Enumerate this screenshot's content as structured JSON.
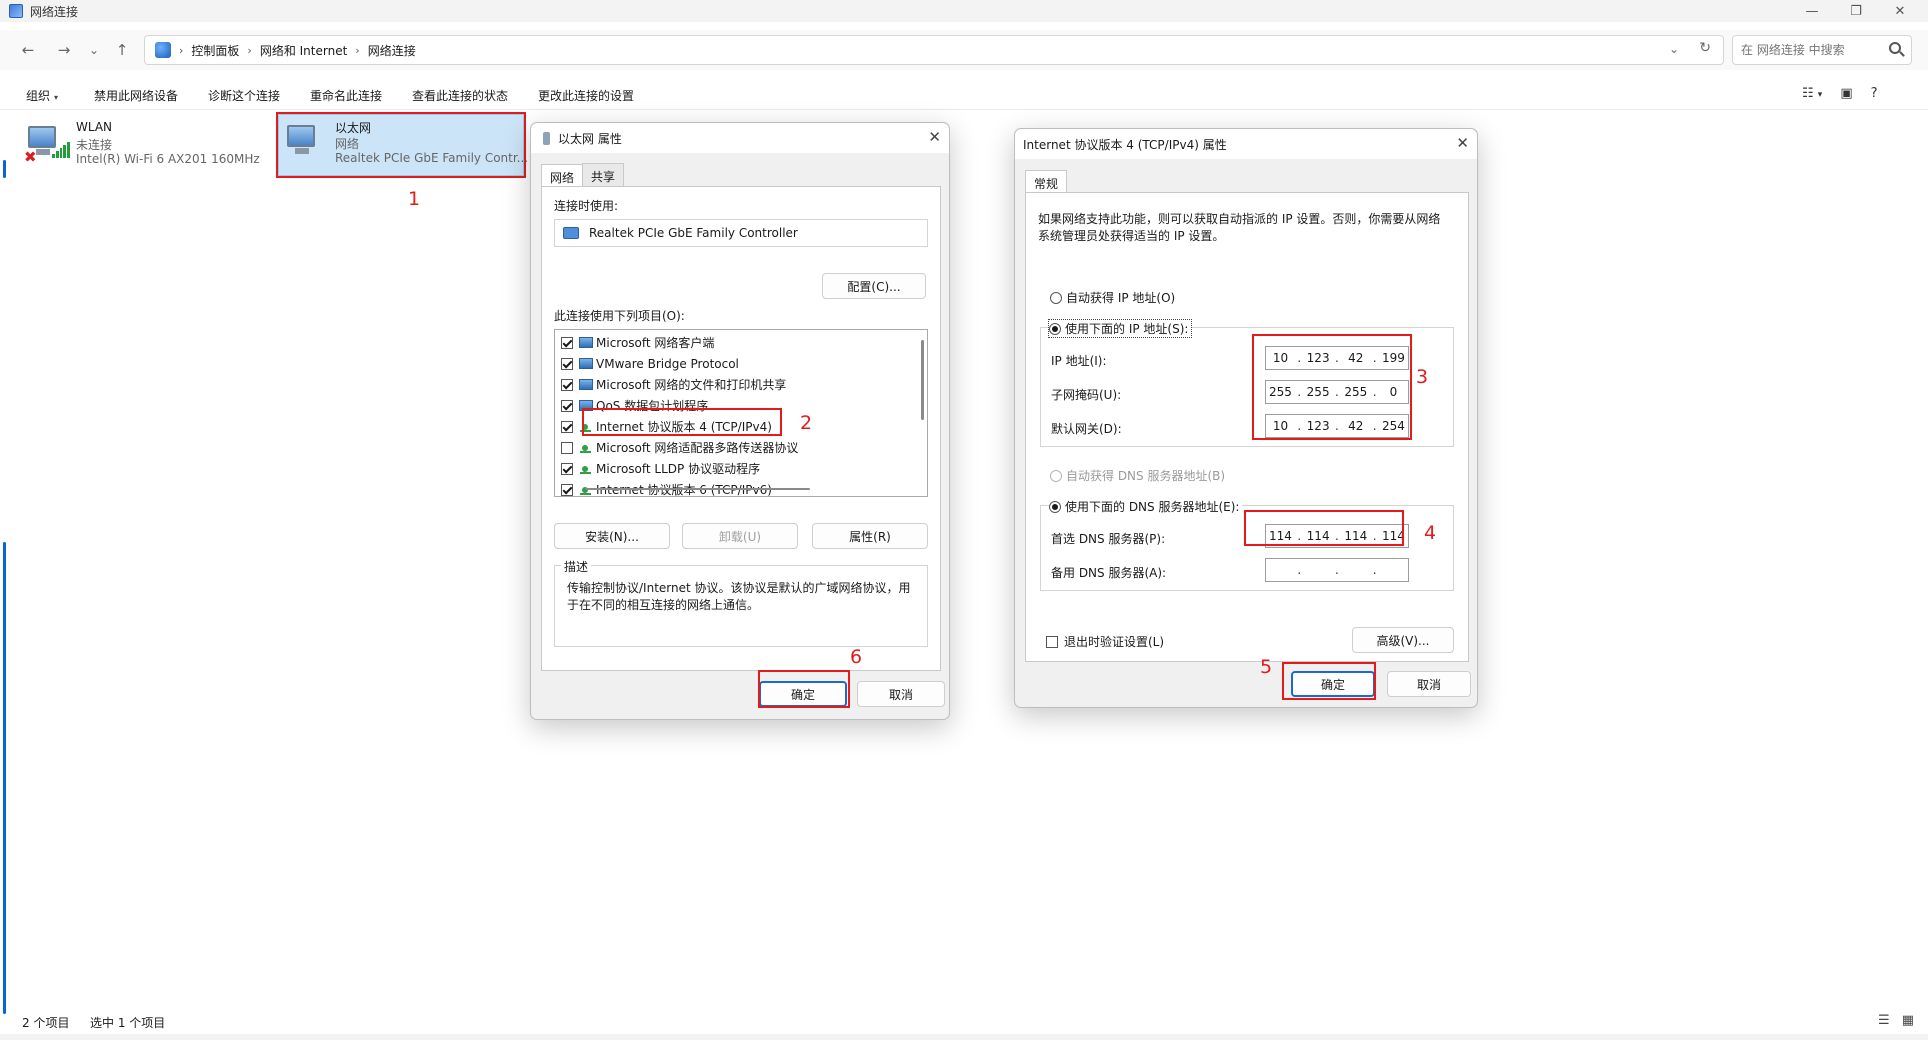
{
  "window": {
    "title": "网络连接",
    "minimize": "—",
    "maximize": "❐",
    "close": "✕"
  },
  "nav": {
    "back": "←",
    "forward": "→",
    "recent": "⌄",
    "up": "↑"
  },
  "address": {
    "separator": "›",
    "crumbs": [
      "控制面板",
      "网络和 Internet",
      "网络连接"
    ],
    "dropdown": "⌄",
    "refresh": "↻"
  },
  "search": {
    "placeholder": "在 网络连接 中搜索"
  },
  "commands": {
    "organize": "组织",
    "organize_caret": "▾",
    "disable": "禁用此网络设备",
    "diagnose": "诊断这个连接",
    "rename": "重命名此连接",
    "view_status": "查看此连接的状态",
    "change_settings": "更改此连接的设置",
    "view_icon": "☷",
    "view_caret": "▾",
    "pane_icon": "▣",
    "help_icon": "?"
  },
  "items": {
    "wlan": {
      "name": "WLAN",
      "status": "未连接",
      "device": "Intel(R) Wi-Fi 6 AX201 160MHz"
    },
    "ethernet": {
      "name": "以太网",
      "status": "网络",
      "device": "Realtek PCIe GbE Family Contr..."
    }
  },
  "annotations": {
    "n1": "1",
    "n2": "2",
    "n3": "3",
    "n4": "4",
    "n5": "5",
    "n6": "6"
  },
  "eth_props": {
    "title": "以太网 属性",
    "close": "✕",
    "tabs": [
      "网络",
      "共享"
    ],
    "connect_using_label": "连接时使用:",
    "device": "Realtek PCIe GbE Family Controller",
    "configure": "配置(C)...",
    "items_label": "此连接使用下列项目(O):",
    "components": [
      {
        "label": "Microsoft 网络客户端",
        "checked": true,
        "icon": "client"
      },
      {
        "label": "VMware Bridge Protocol",
        "checked": true,
        "icon": "client"
      },
      {
        "label": "Microsoft 网络的文件和打印机共享",
        "checked": true,
        "icon": "client"
      },
      {
        "label": "QoS 数据包计划程序",
        "checked": true,
        "icon": "client"
      },
      {
        "label": "Internet 协议版本 4 (TCP/IPv4)",
        "checked": true,
        "icon": "proto"
      },
      {
        "label": "Microsoft 网络适配器多路传送器协议",
        "checked": false,
        "icon": "proto"
      },
      {
        "label": "Microsoft LLDP 协议驱动程序",
        "checked": true,
        "icon": "proto"
      },
      {
        "label": "Internet 协议版本 6 (TCP/IPv6)",
        "checked": true,
        "icon": "proto"
      }
    ],
    "install": "安装(N)...",
    "uninstall": "卸载(U)",
    "properties": "属性(R)",
    "desc_label": "描述",
    "description": "传输控制协议/Internet 协议。该协议是默认的广域网络协议，用于在不同的相互连接的网络上通信。",
    "ok": "确定",
    "cancel": "取消"
  },
  "ipv4": {
    "title": "Internet 协议版本 4 (TCP/IPv4) 属性",
    "close": "✕",
    "tab": "常规",
    "intro": "如果网络支持此功能，则可以获取自动指派的 IP 设置。否则，你需要从网络系统管理员处获得适当的 IP 设置。",
    "auto_ip": "自动获得 IP 地址(O)",
    "manual_ip": "使用下面的 IP 地址(S):",
    "ip_label": "IP 地址(I):",
    "ip": [
      "10",
      "123",
      "42",
      "199"
    ],
    "mask_label": "子网掩码(U):",
    "mask": [
      "255",
      "255",
      "255",
      "0"
    ],
    "gateway_label": "默认网关(D):",
    "gateway": [
      "10",
      "123",
      "42",
      "254"
    ],
    "auto_dns": "自动获得 DNS 服务器地址(B)",
    "manual_dns": "使用下面的 DNS 服务器地址(E):",
    "pref_dns_label": "首选 DNS 服务器(P):",
    "pref_dns": [
      "114",
      "114",
      "114",
      "114"
    ],
    "alt_dns_label": "备用 DNS 服务器(A):",
    "alt_dns": [
      "",
      "",
      "",
      ""
    ],
    "validate": "退出时验证设置(L)",
    "advanced": "高级(V)...",
    "ok": "确定",
    "cancel": "取消",
    "dot": "."
  },
  "status": {
    "count": "2 个项目",
    "selected": "选中 1 个项目",
    "details_icon": "☰",
    "tiles_icon": "▦"
  },
  "colors": {
    "accent": "#1d68d4",
    "annotation": "#e31b1b",
    "selection": "#cce4f7"
  }
}
